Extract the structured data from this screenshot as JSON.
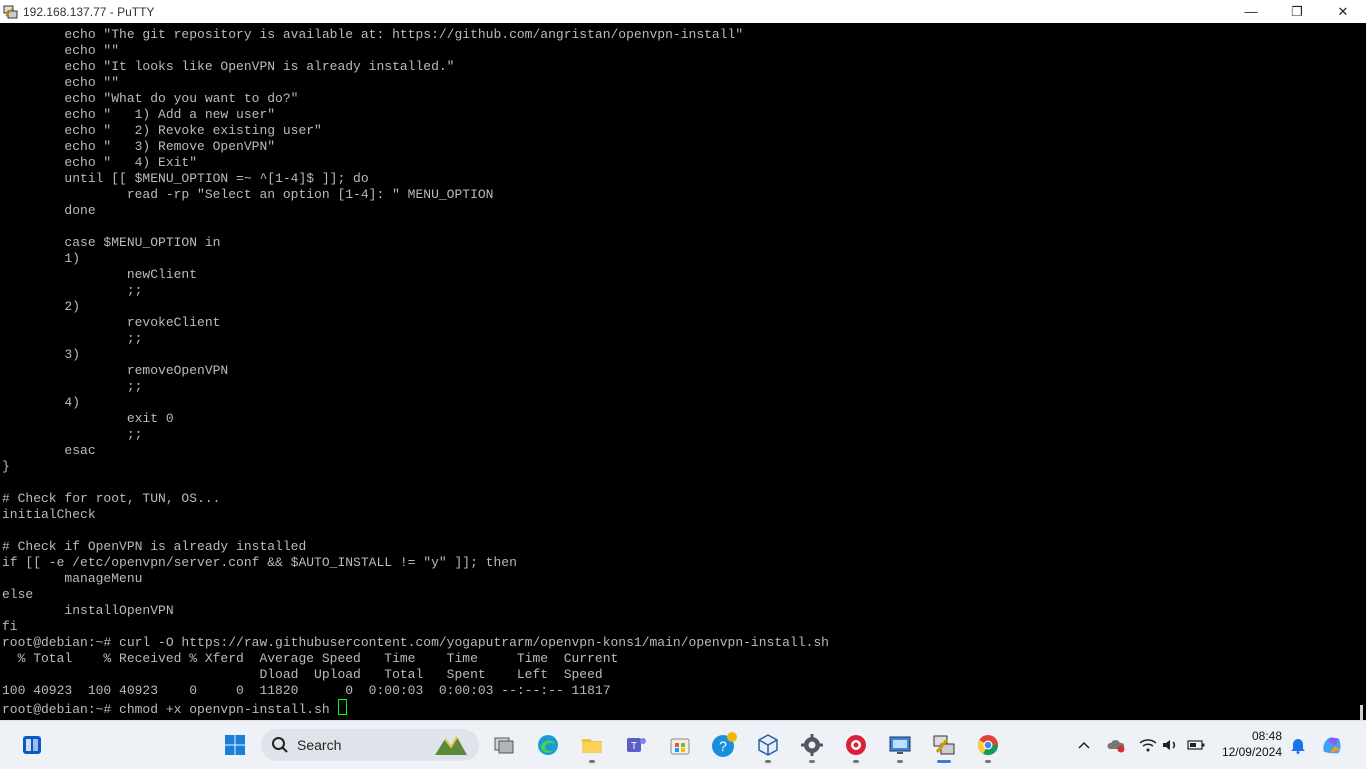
{
  "window": {
    "title": "192.168.137.77 - PuTTY",
    "controls": [
      "—",
      "❐",
      "✕"
    ]
  },
  "terminal": {
    "lines": [
      "        echo \"The git repository is available at: https://github.com/angristan/openvpn-install\"",
      "        echo \"\"",
      "        echo \"It looks like OpenVPN is already installed.\"",
      "        echo \"\"",
      "        echo \"What do you want to do?\"",
      "        echo \"   1) Add a new user\"",
      "        echo \"   2) Revoke existing user\"",
      "        echo \"   3) Remove OpenVPN\"",
      "        echo \"   4) Exit\"",
      "        until [[ $MENU_OPTION =~ ^[1-4]$ ]]; do",
      "                read -rp \"Select an option [1-4]: \" MENU_OPTION",
      "        done",
      "",
      "        case $MENU_OPTION in",
      "        1)",
      "                newClient",
      "                ;;",
      "        2)",
      "                revokeClient",
      "                ;;",
      "        3)",
      "                removeOpenVPN",
      "                ;;",
      "        4)",
      "                exit 0",
      "                ;;",
      "        esac",
      "}",
      "",
      "# Check for root, TUN, OS...",
      "initialCheck",
      "",
      "# Check if OpenVPN is already installed",
      "if [[ -e /etc/openvpn/server.conf && $AUTO_INSTALL != \"y\" ]]; then",
      "        manageMenu",
      "else",
      "        installOpenVPN",
      "fi",
      "root@debian:~# curl -O https://raw.githubusercontent.com/yogaputrarm/openvpn-kons1/main/openvpn-install.sh",
      "  % Total    % Received % Xferd  Average Speed   Time    Time     Time  Current",
      "                                 Dload  Upload   Total   Spent    Left  Speed",
      "100 40923  100 40923    0     0  11820      0  0:00:03  0:00:03 --:--:-- 11817",
      "root@debian:~# chmod +x openvpn-install.sh "
    ]
  },
  "taskbar": {
    "search_label": "Search",
    "time": "08:48",
    "date": "12/09/2024",
    "apps": [
      "widgets-icon",
      "start-icon",
      "task-view-icon",
      "edge-icon",
      "file-explorer-icon",
      "teams-icon",
      "store-icon",
      "help-icon",
      "virtualbox-icon",
      "settings-icon",
      "app-icon",
      "remote-desktop-icon",
      "putty-icon",
      "chrome-icon"
    ],
    "tray": [
      "chevron-up-icon",
      "onedrive-icon",
      "wifi-icon",
      "volume-icon",
      "battery-icon",
      "notification-bell-icon",
      "copilot-icon"
    ]
  }
}
